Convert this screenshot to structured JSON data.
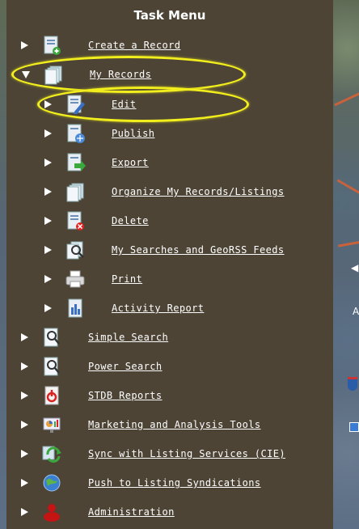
{
  "panel": {
    "title": "Task Menu"
  },
  "menu": [
    {
      "label": "Create a Record",
      "icon": "document-add-icon"
    },
    {
      "label": "My Records",
      "icon": "records-stack-icon",
      "expanded": true
    },
    {
      "label": "Edit",
      "icon": "document-edit-icon"
    },
    {
      "label": "Publish",
      "icon": "document-publish-icon"
    },
    {
      "label": "Export",
      "icon": "document-export-icon"
    },
    {
      "label": "Organize My Records/Listings",
      "icon": "records-organize-icon"
    },
    {
      "label": "Delete",
      "icon": "document-delete-icon"
    },
    {
      "label": "My Searches and GeoRSS Feeds",
      "icon": "saved-search-icon"
    },
    {
      "label": "Print",
      "icon": "printer-icon"
    },
    {
      "label": "Activity Report",
      "icon": "report-icon"
    },
    {
      "label": "Simple Search",
      "icon": "magnifier-icon"
    },
    {
      "label": "Power Search",
      "icon": "power-search-icon"
    },
    {
      "label": "STDB Reports",
      "icon": "stdb-report-icon"
    },
    {
      "label": "Marketing and Analysis Tools",
      "icon": "analysis-tools-icon"
    },
    {
      "label": "Sync with Listing Services (CIE)",
      "icon": "sync-icon"
    },
    {
      "label": "Push to Listing Syndications",
      "icon": "globe-icon"
    },
    {
      "label": "Administration",
      "icon": "admin-icon"
    }
  ],
  "map": {
    "label_fragment": "A"
  },
  "colors": {
    "panel_bg": "#4d4436",
    "highlight": "#f2ee1e",
    "text": "#ffffff"
  }
}
